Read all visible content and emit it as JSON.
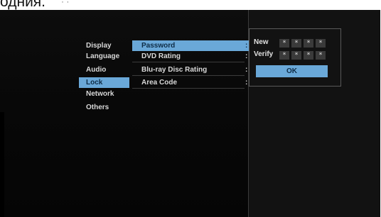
{
  "top_caption": {
    "text": "одния.",
    "trail": "·  ·"
  },
  "left_menu": {
    "items": [
      {
        "label": "Display"
      },
      {
        "label": "Language"
      },
      {
        "label": "Audio"
      },
      {
        "label": "Lock",
        "selected": true
      },
      {
        "label": "Network"
      },
      {
        "label": "Others"
      }
    ]
  },
  "lock_menu": {
    "items": [
      {
        "label": "Password",
        "selected": true
      },
      {
        "label": "DVD Rating"
      },
      {
        "label": "Blu-ray Disc Rating"
      },
      {
        "label": "Area Code"
      }
    ],
    "separator": ":"
  },
  "password_panel": {
    "new_label": "New",
    "verify_label": "Verify",
    "mask_char": "*",
    "new_digits": [
      "*",
      "*",
      "*",
      "*"
    ],
    "verify_digits": [
      "*",
      "*",
      "*",
      "*"
    ],
    "ok_label": "OK"
  },
  "colors": {
    "highlight": "#6aa8d8",
    "background": "#0b0b0b",
    "text": "#d8d8d8"
  }
}
